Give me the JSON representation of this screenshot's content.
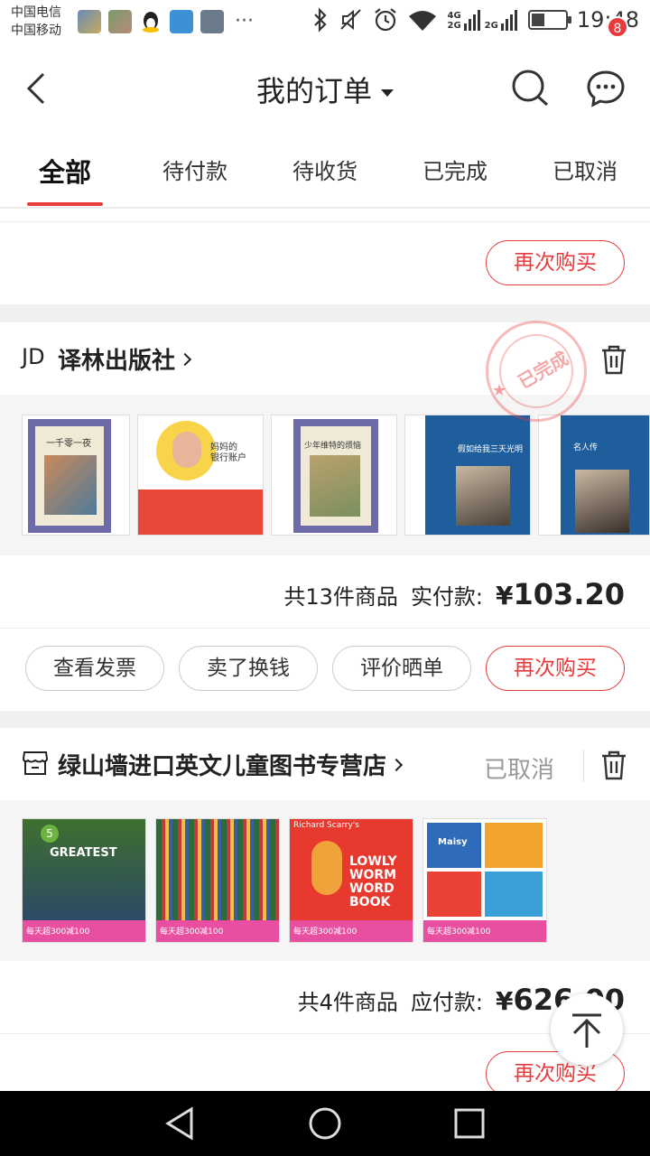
{
  "statusbar": {
    "carrier1": "中国电信",
    "carrier2": "中国移动",
    "net1": "4G",
    "net2": "2G",
    "net3": "2G",
    "time": "19:48",
    "more": "···"
  },
  "header": {
    "title": "我的订单",
    "message_badge": "8"
  },
  "tabs": [
    "全部",
    "待付款",
    "待收货",
    "已完成",
    "已取消"
  ],
  "top_partial": {
    "rebuy_label": "再次购买"
  },
  "order1": {
    "shop_logo": "JD",
    "shop_name": "译林出版社",
    "stamp": "已完成",
    "summary_count": "共13件商品",
    "summary_label": "实付款:",
    "currency": "¥",
    "amount": "103.20",
    "actions": [
      "查看发票",
      "卖了换钱",
      "评价晒单",
      "再次购买"
    ]
  },
  "order2": {
    "shop_name": "绿山墙进口英文儿童图书专营店",
    "status": "已取消",
    "summary_count": "共4件商品",
    "summary_label": "应付款:",
    "currency": "¥",
    "amount": "626.00",
    "rebuy_label": "再次购买"
  },
  "book_texts": {
    "b1": "一千零一夜",
    "b2_1": "妈妈的",
    "b2_2": "银行账户",
    "b3": "少年维特的烦恼",
    "b4": "假如给我三天光明",
    "b5": "名人传",
    "k1_num": "5",
    "k1_title": "GREATEST",
    "k3_brand": "Richard Scarry's",
    "k3_title": "LOWLY WORM WORD BOOK",
    "k4_title": "Maisy",
    "promo": "每天超300减100"
  },
  "colors": {
    "accent": "#e93b3d",
    "tab_underline": "#e93b3d"
  },
  "icons": [
    "back-icon",
    "search-icon",
    "message-icon",
    "trash-icon",
    "store-icon",
    "back-to-top-icon",
    "nav-back-icon",
    "nav-home-icon",
    "nav-recents-icon"
  ]
}
